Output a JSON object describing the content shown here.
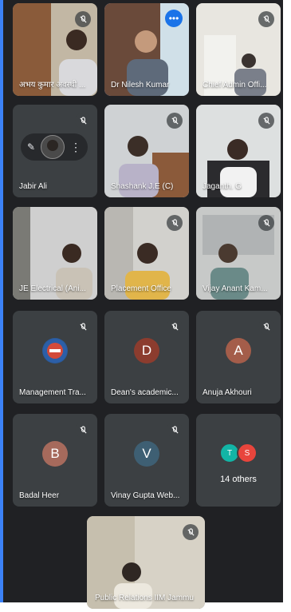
{
  "participants": [
    {
      "name": "अभय कुमार अवस्थी ...",
      "kind": "video",
      "muted": true
    },
    {
      "name": "Dr Nilesh Kumar",
      "kind": "video",
      "muted": false,
      "active": true,
      "more_icon": "more-horiz-icon"
    },
    {
      "name": "Chief Admin Offi...",
      "kind": "video",
      "muted": true
    },
    {
      "name": "Jabir Ali",
      "kind": "pinned-avatar",
      "muted": true
    },
    {
      "name": "Shashank J.E (C)",
      "kind": "video",
      "muted": true
    },
    {
      "name": "Jaganth. G",
      "kind": "video",
      "muted": true
    },
    {
      "name": "JE Electrical (Ani...",
      "kind": "video",
      "muted": false
    },
    {
      "name": "Placement Office",
      "kind": "video",
      "muted": true
    },
    {
      "name": "Vijay Anant Kam...",
      "kind": "video",
      "muted": true
    },
    {
      "name": "Management Tra...",
      "kind": "logo-avatar",
      "muted": true
    },
    {
      "name": "Dean's academic...",
      "kind": "avatar",
      "initial": "D",
      "avatar_color": "#8c3c2e",
      "muted": true
    },
    {
      "name": "Anuja Akhouri",
      "kind": "avatar",
      "initial": "A",
      "avatar_color": "#a45d4a",
      "muted": true
    },
    {
      "name": "Badal Heer",
      "kind": "avatar",
      "initial": "B",
      "avatar_color": "#a66a5c",
      "muted": true
    },
    {
      "name": "Vinay Gupta Web...",
      "kind": "avatar",
      "initial": "V",
      "avatar_color": "#3e5f73",
      "muted": true
    },
    {
      "name": "Public Relations IIM Jammu",
      "kind": "video",
      "muted": true
    }
  ],
  "others": {
    "label": "14 others",
    "avatars": [
      {
        "initial": "T",
        "color": "#12b5a6"
      },
      {
        "initial": "S",
        "color": "#e8453c"
      }
    ]
  },
  "colors": {
    "background": "#202124",
    "tile": "#3c4043",
    "accent": "#8ab4f8"
  }
}
